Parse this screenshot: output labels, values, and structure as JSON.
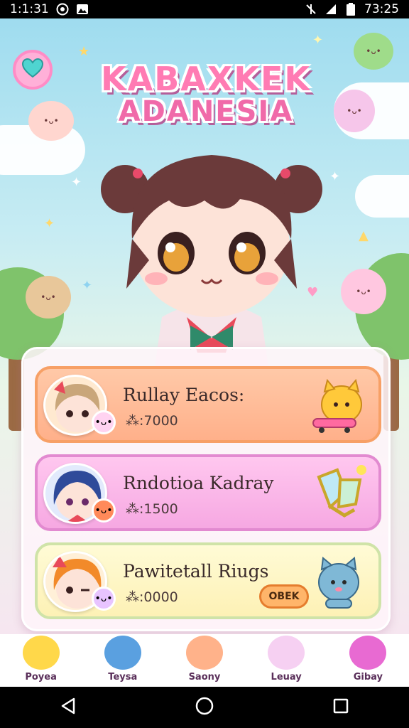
{
  "status_bar": {
    "time_left": "1:1:31",
    "time_right": "73:25"
  },
  "game": {
    "title_line1": "KABAXKEK",
    "title_line2": "ADANESIA"
  },
  "cards": [
    {
      "title": "Rullay Eacos:",
      "price": "⁂:7000",
      "accent": "#f7a066"
    },
    {
      "title": "Rndotioa Kadray",
      "price": "⁂:1500",
      "accent": "#e28ad0"
    },
    {
      "title": "Pawitetall Riugs",
      "price": "⁂:0000",
      "button": "OBEK",
      "accent": "#cfe3a8"
    }
  ],
  "tabs": [
    {
      "label": "Poyea",
      "color": "#ffd84a"
    },
    {
      "label": "Teysa",
      "color": "#5aa0e0"
    },
    {
      "label": "Saony",
      "color": "#ffb28a"
    },
    {
      "label": "Leuay",
      "color": "#f6d0f2"
    },
    {
      "label": "Gibay",
      "color": "#e86ad2"
    }
  ]
}
